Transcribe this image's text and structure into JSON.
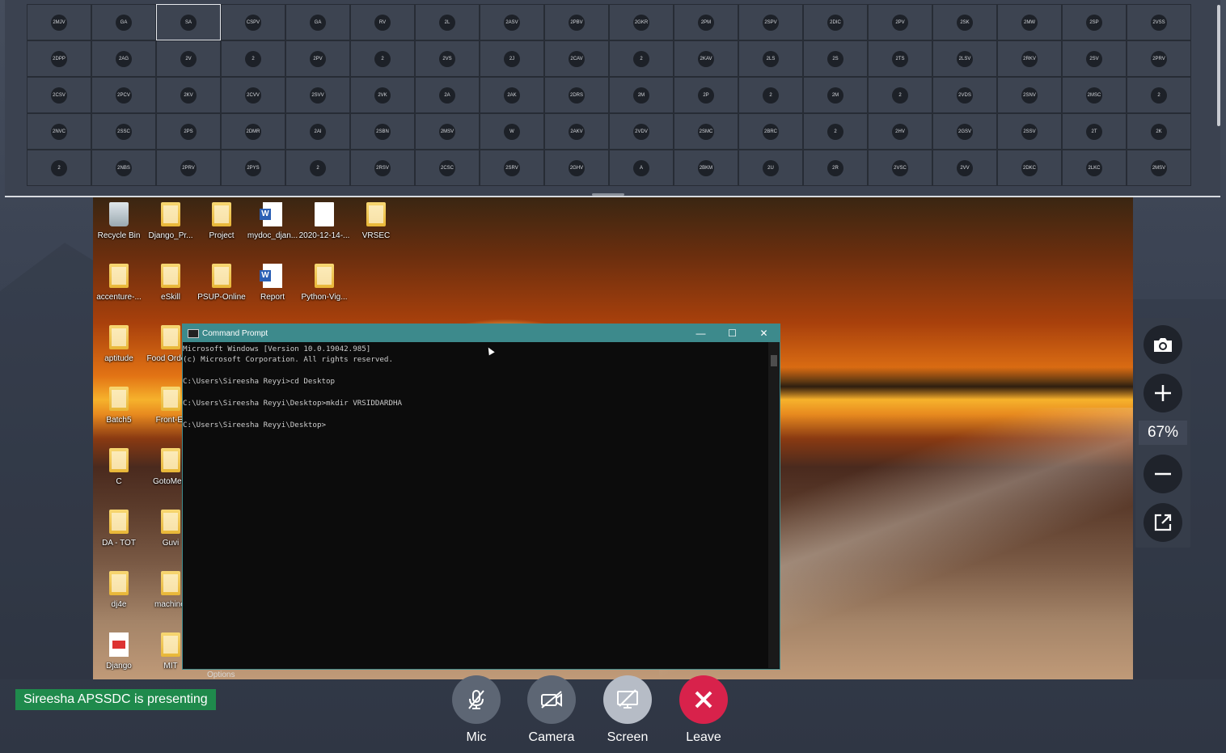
{
  "grid": {
    "tiles": [
      "2MJV",
      "GA",
      "SA",
      "CSPV",
      "GA",
      "RV",
      "2L",
      "2ASV",
      "2PBV",
      "2GKR",
      "2PM",
      "2SPV",
      "2DIC",
      "2PV",
      "2SK",
      "2MW",
      "2SP",
      "2VSS",
      "2DPP",
      "2AG",
      "2V",
      "2",
      "2PV",
      "2",
      "2VS",
      "2J",
      "2CAV",
      "2",
      "2KAV",
      "2LS",
      "2S",
      "2TS",
      "2LSV",
      "2RKV",
      "2SV",
      "2PRV",
      "2CSV",
      "2PCV",
      "2KV",
      "2CVV",
      "2SVV",
      "2VK",
      "2A",
      "2AK",
      "2DRS",
      "2M",
      "2P",
      "2",
      "2M",
      "2",
      "2VDS",
      "2SNV",
      "2MSC",
      "2",
      "2NVC",
      "2SSC",
      "2PS",
      "2DMR",
      "2AI",
      "2SBN",
      "2MSV",
      "W",
      "2AKV",
      "2VDV",
      "2SMC",
      "2BRC",
      "2",
      "2HV",
      "2GSV",
      "2SSV",
      "2T",
      "2K",
      "2",
      "2NBS",
      "2PRV",
      "2PYS",
      "2",
      "2RSV",
      "2CSC",
      "2SRV",
      "2GHV",
      "A",
      "2BKM",
      "2U",
      "2R",
      "2VSC",
      "2VV",
      "2DKC",
      "2LKC",
      "2MSV"
    ],
    "active_index": 2
  },
  "desktop": {
    "icons": [
      {
        "label": "Recycle Bin",
        "kind": "bin"
      },
      {
        "label": "Django_Pr...",
        "kind": "folder"
      },
      {
        "label": "Project",
        "kind": "folder"
      },
      {
        "label": "mydoc_djan...",
        "kind": "word"
      },
      {
        "label": "2020-12-14-...",
        "kind": "doc"
      },
      {
        "label": "VRSEC",
        "kind": "folder"
      },
      {
        "label": "accenture-...",
        "kind": "folder"
      },
      {
        "label": "eSkill",
        "kind": "folder"
      },
      {
        "label": "PSUP-Online",
        "kind": "folder"
      },
      {
        "label": "Report",
        "kind": "word"
      },
      {
        "label": "Python-Vig...",
        "kind": "folder"
      },
      {
        "label": "aptitude",
        "kind": "folder"
      },
      {
        "label": "Food Orderin",
        "kind": "folder"
      },
      {
        "label": "Batch5",
        "kind": "folder"
      },
      {
        "label": "Front-Er",
        "kind": "folder"
      },
      {
        "label": "C",
        "kind": "folder"
      },
      {
        "label": "GotoMeet",
        "kind": "folder"
      },
      {
        "label": "DA - TOT",
        "kind": "folder"
      },
      {
        "label": "Guvi",
        "kind": "folder"
      },
      {
        "label": "dj4e",
        "kind": "folder"
      },
      {
        "label": "machinel",
        "kind": "folder"
      },
      {
        "label": "Django",
        "kind": "pdf"
      },
      {
        "label": "MIT",
        "kind": "folder"
      }
    ],
    "options_label": "Options"
  },
  "cmd": {
    "title": "Command Prompt",
    "minimize": "—",
    "maximize": "☐",
    "close": "✕",
    "lines": [
      "Microsoft Windows [Version 10.0.19042.985]",
      "(c) Microsoft Corporation. All rights reserved.",
      "",
      "C:\\Users\\Sireesha Reyyi>cd Desktop",
      "",
      "C:\\Users\\Sireesha Reyyi\\Desktop>mkdir VRSIDDARDHA",
      "",
      "C:\\Users\\Sireesha Reyyi\\Desktop>"
    ]
  },
  "zoom": {
    "value": "67%"
  },
  "presenting": "Sireesha APSSDC is presenting",
  "controls": {
    "mic": "Mic",
    "camera": "Camera",
    "screen": "Screen",
    "leave": "Leave"
  },
  "colors": {
    "leave": "#d8224b",
    "controls": "#5d6674",
    "screen_active": "#b6bcc6",
    "presenting_badge": "#1f8a4c"
  }
}
